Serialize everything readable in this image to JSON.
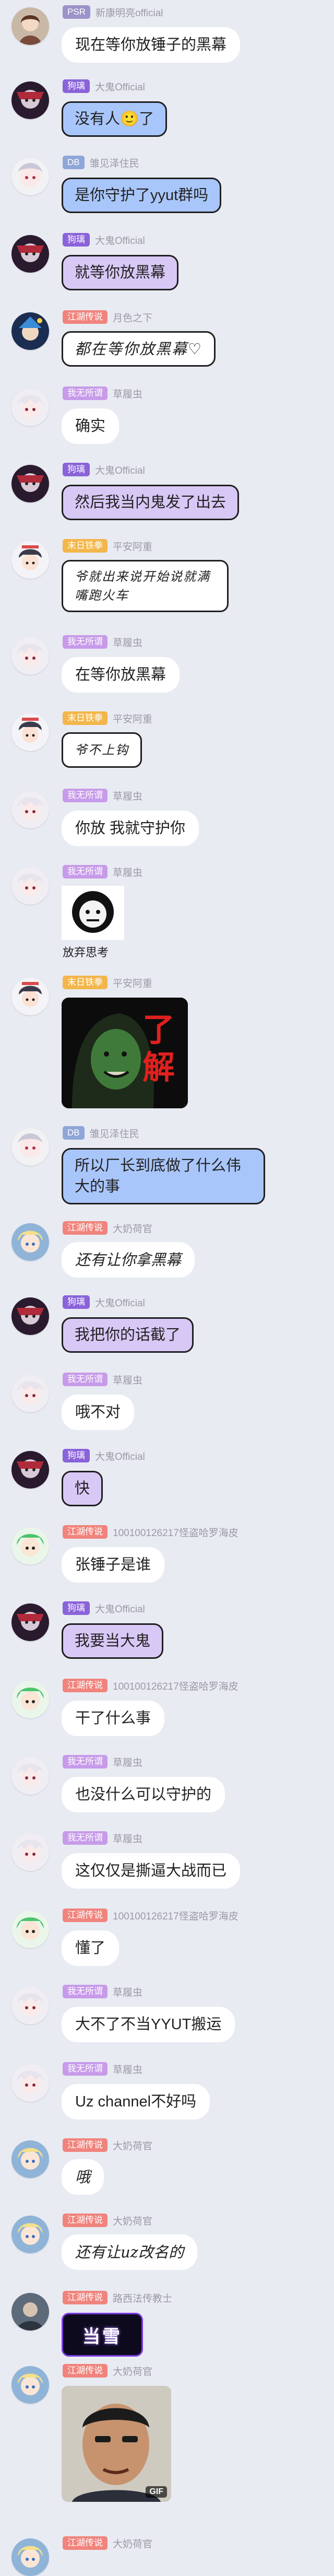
{
  "colors": {
    "background": "#e9ebf3",
    "badge_psr": "#9b93c9",
    "badge_jitu": "#8a63d9",
    "badge_db": "#8fa6d9",
    "badge_jianghu": "#f0847d",
    "badge_weiwu": "#c79be9",
    "badge_mori": "#f2b64a",
    "bubble_blue": "#a9c6fb",
    "bubble_purple": "#d8c8f6"
  },
  "messages": [
    {
      "badge": "PSR",
      "nick": "新康明亮official",
      "text": "现在等你放锤子的黑幕"
    },
    {
      "badge": "狗璃",
      "nick": "大鬼Official",
      "text": "没有人🙂了"
    },
    {
      "badge": "DB",
      "nick": "雏见泽住民",
      "text": "是你守护了yyut群吗"
    },
    {
      "badge": "狗璃",
      "nick": "大鬼Official",
      "text": "就等你放黑幕"
    },
    {
      "badge": "江湖传说",
      "nick": "月色之下",
      "text": "都在等你放黑幕♡"
    },
    {
      "badge": "我无所谓",
      "nick": "草履虫",
      "text": "确实"
    },
    {
      "badge": "狗璃",
      "nick": "大鬼Official",
      "text": "然后我当内鬼发了出去"
    },
    {
      "badge": "末日铁拳",
      "nick": "平安阿重",
      "text": "爷就出来说开始说就满嘴跑火车"
    },
    {
      "badge": "我无所谓",
      "nick": "草履虫",
      "text": "在等你放黑幕"
    },
    {
      "badge": "末日铁拳",
      "nick": "平安阿重",
      "text": "爷不上钩"
    },
    {
      "badge": "我无所谓",
      "nick": "草履虫",
      "text": "你放 我就守护你"
    },
    {
      "badge": "我无所谓",
      "nick": "草履虫",
      "sticker_caption": "放弃思考"
    },
    {
      "badge": "末日铁拳",
      "nick": "平安阿重",
      "sticker_text": "了解"
    },
    {
      "badge": "DB",
      "nick": "雏见泽住民",
      "text": "所以厂长到底做了什么伟大的事"
    },
    {
      "badge": "江湖传说",
      "nick": "大奶荷官",
      "text": "还有让你拿黑幕"
    },
    {
      "badge": "狗璃",
      "nick": "大鬼Official",
      "text": "我把你的话截了"
    },
    {
      "badge": "我无所谓",
      "nick": "草履虫",
      "text": "哦不对"
    },
    {
      "badge": "狗璃",
      "nick": "大鬼Official",
      "text": "快"
    },
    {
      "badge": "江湖传说",
      "nick": "100100126217怪盗哈罗海皮",
      "text": "张锤子是谁"
    },
    {
      "badge": "狗璃",
      "nick": "大鬼Official",
      "text": "我要当大鬼"
    },
    {
      "badge": "江湖传说",
      "nick": "100100126217怪盗哈罗海皮",
      "text": "干了什么事"
    },
    {
      "badge": "我无所谓",
      "nick": "草履虫",
      "text": "也没什么可以守护的"
    },
    {
      "badge": "我无所谓",
      "nick": "草履虫",
      "text": "这仅仅是撕逼大战而已"
    },
    {
      "badge": "江湖传说",
      "nick": "100100126217怪盗哈罗海皮",
      "text": "懂了"
    },
    {
      "badge": "我无所谓",
      "nick": "草履虫",
      "text": "大不了不当YYUT搬运"
    },
    {
      "badge": "我无所谓",
      "nick": "草履虫",
      "text": "Uz channel不好吗"
    },
    {
      "badge": "江湖传说",
      "nick": "大奶荷官",
      "text": "哦"
    },
    {
      "badge": "江湖传说",
      "nick": "大奶荷官",
      "text": "还有让uz改名的"
    },
    {
      "badge": "江湖传说",
      "nick": "路西法传教士",
      "sticker_text": "当雪"
    },
    {
      "badge": "江湖传说",
      "nick": "大奶荷官",
      "gif_label": "GIF"
    },
    {
      "badge": "江湖传说",
      "nick": "大奶荷官"
    }
  ]
}
